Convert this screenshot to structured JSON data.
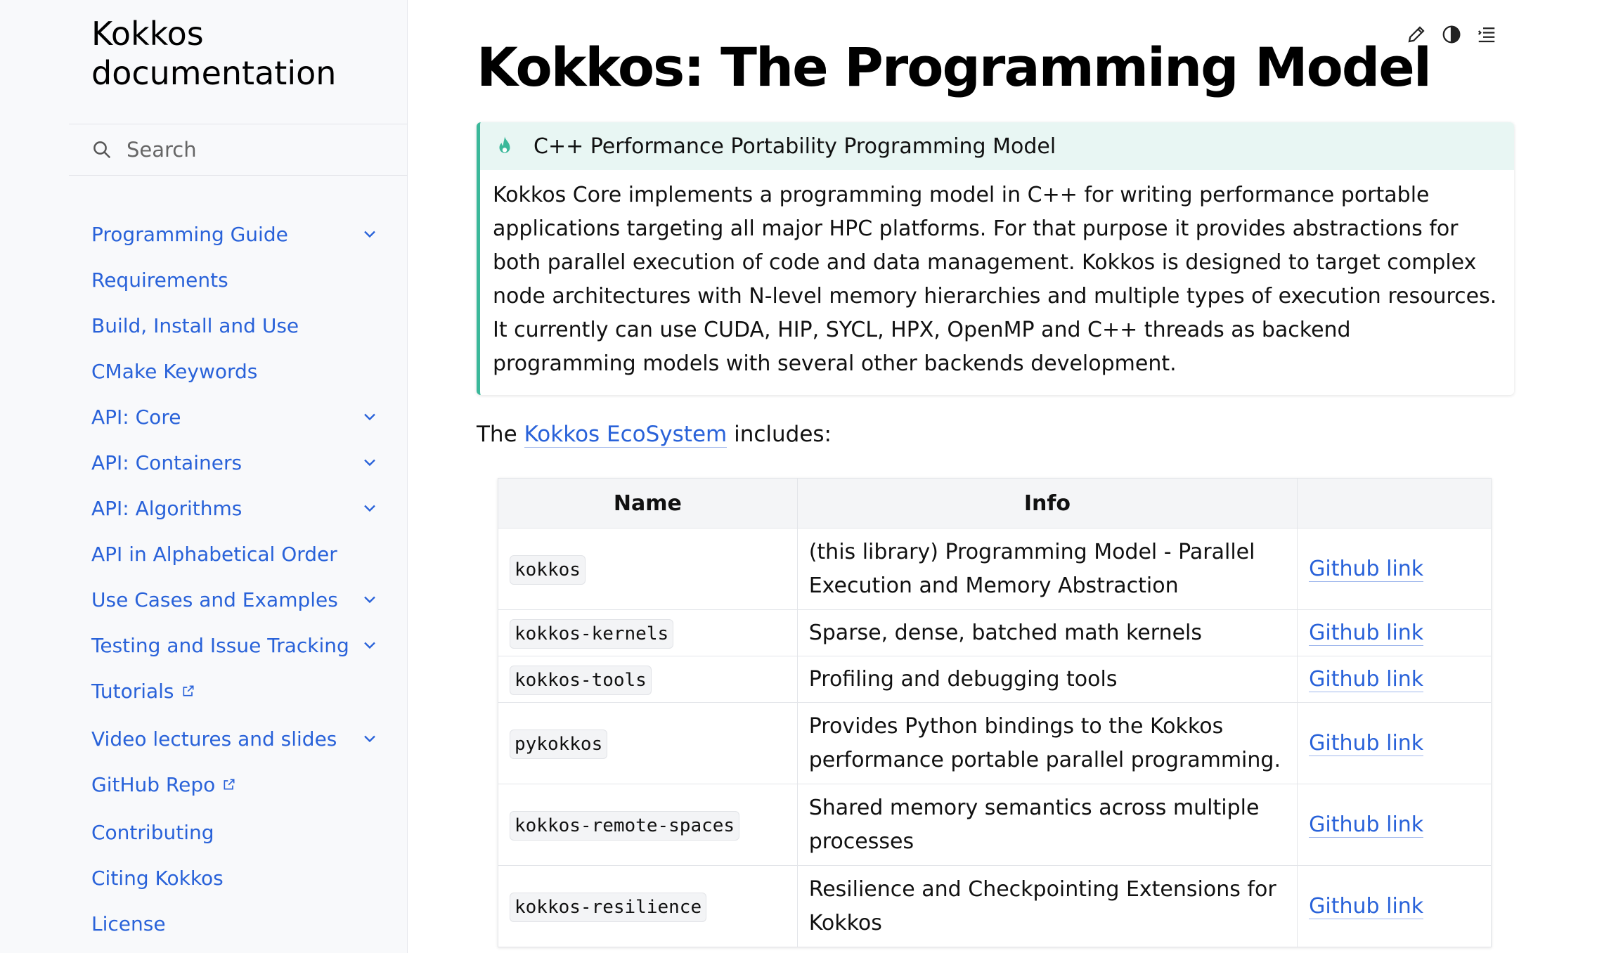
{
  "sidebar": {
    "brand": "Kokkos documentation",
    "search_placeholder": "Search",
    "items": [
      {
        "label": "Programming Guide",
        "expandable": true
      },
      {
        "label": "Requirements",
        "expandable": false
      },
      {
        "label": "Build, Install and Use",
        "expandable": false
      },
      {
        "label": "CMake Keywords",
        "expandable": false
      },
      {
        "label": "API: Core",
        "expandable": true
      },
      {
        "label": "API: Containers",
        "expandable": true
      },
      {
        "label": "API: Algorithms",
        "expandable": true
      },
      {
        "label": "API in Alphabetical Order",
        "expandable": false
      },
      {
        "label": "Use Cases and Examples",
        "expandable": true
      },
      {
        "label": "Testing and Issue Tracking",
        "expandable": true
      },
      {
        "label": "Tutorials",
        "expandable": false,
        "external": true
      },
      {
        "label": "Video lectures and slides",
        "expandable": true
      },
      {
        "label": "GitHub Repo",
        "expandable": false,
        "external": true
      },
      {
        "label": "Contributing",
        "expandable": false
      },
      {
        "label": "Citing Kokkos",
        "expandable": false
      },
      {
        "label": "License",
        "expandable": false
      }
    ]
  },
  "toolbar": {
    "icons": [
      "pencil-icon",
      "theme-toggle-icon",
      "toc-icon"
    ]
  },
  "main": {
    "title": "Kokkos: The Programming Model",
    "admonition": {
      "icon": "flame-icon",
      "heading": "C++ Performance Portability Programming Model",
      "body": "Kokkos Core implements a programming model in C++ for writing performance portable applications targeting all major HPC platforms. For that purpose it provides abstractions for both parallel execution of code and data management. Kokkos is designed to target complex node architectures with N-level memory hierarchies and multiple types of execution resources. It currently can use CUDA, HIP, SYCL, HPX, OpenMP and C++ threads as backend programming models with several other backends development."
    },
    "intro": {
      "prefix": "The",
      "link": "Kokkos EcoSystem",
      "suffix": "includes:"
    },
    "table": {
      "headers": [
        "Name",
        "Info",
        ""
      ],
      "rows": [
        {
          "name": "kokkos",
          "info": "(this library) Programming Model - Parallel Execution and Memory Abstraction",
          "link": "Github link"
        },
        {
          "name": "kokkos-kernels",
          "info": "Sparse, dense, batched math kernels",
          "link": "Github link"
        },
        {
          "name": "kokkos-tools",
          "info": "Profiling and debugging tools",
          "link": "Github link"
        },
        {
          "name": "pykokkos",
          "info": "Provides Python bindings to the Kokkos performance portable parallel programming.",
          "link": "Github link"
        },
        {
          "name": "kokkos-remote-spaces",
          "info": "Shared memory semantics across multiple processes",
          "link": "Github link"
        },
        {
          "name": "kokkos-resilience",
          "info": "Resilience and Checkpointing Extensions for Kokkos",
          "link": "Github link"
        }
      ]
    }
  },
  "colors": {
    "link": "#2962d9",
    "admonition_accent": "#3bb89a",
    "admonition_header_bg": "#e8f6f3",
    "sidebar_bg": "#f8f9fb"
  }
}
